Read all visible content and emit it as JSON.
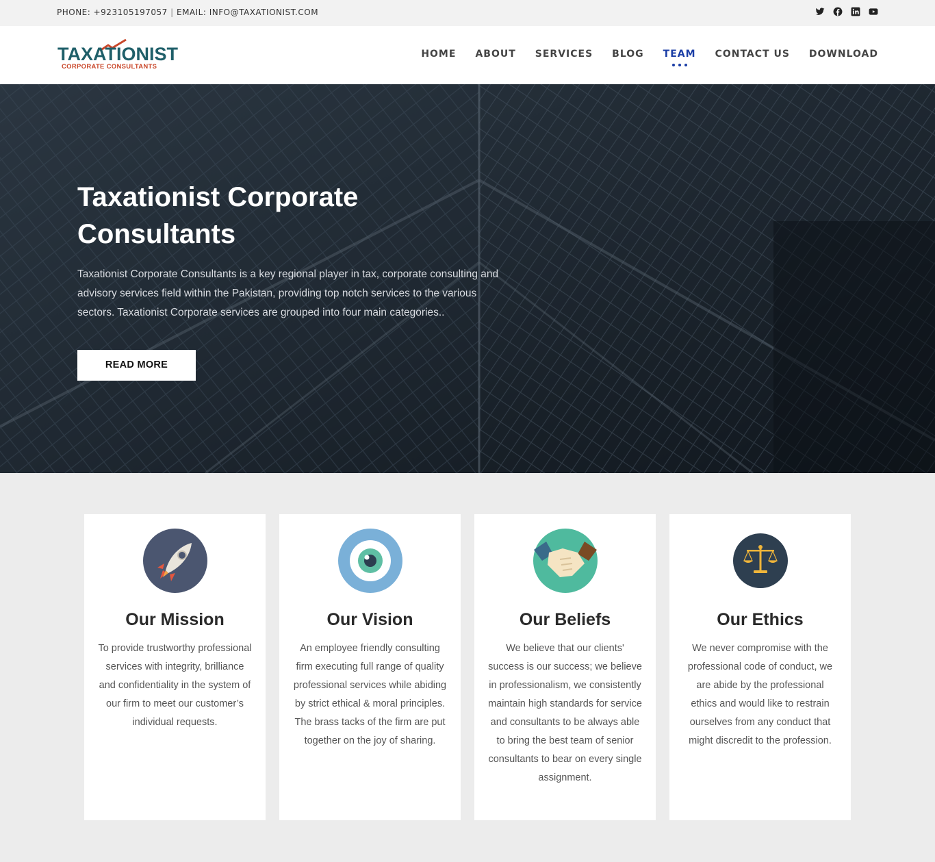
{
  "topbar": {
    "contact_text": "PHONE: +923105197057",
    "separator": "|",
    "email_text": "EMAIL: INFO@TAXATIONIST.COM",
    "social_icons": [
      "twitter-icon",
      "facebook-icon",
      "linkedin-icon",
      "youtube-icon"
    ]
  },
  "logo": {
    "main": "TAXATIONIST",
    "sub": "CORPORATE CONSULTANTS"
  },
  "nav": {
    "items": [
      {
        "label": "HOME"
      },
      {
        "label": "ABOUT"
      },
      {
        "label": "SERVICES"
      },
      {
        "label": "BLOG"
      },
      {
        "label": "TEAM"
      },
      {
        "label": "CONTACT US"
      },
      {
        "label": "DOWNLOAD"
      }
    ],
    "active": "TEAM",
    "active_color": "#1b3ea6"
  },
  "hero": {
    "title": "Taxationist Corporate Consultants",
    "description": "Taxationist Corporate Consultants is a key regional player in tax, corporate consulting and advisory services field within the Pakistan, providing top notch services to the various sectors. Taxationist Corporate services are grouped into four main categories..",
    "button_label": "READ MORE"
  },
  "cards": [
    {
      "icon": "rocket-icon",
      "title": "Our Mission",
      "text": "To provide trustworthy professional services with integrity, brilliance and confidentiality in the system of our firm to meet our customer’s individual requests."
    },
    {
      "icon": "eye-icon",
      "title": "Our Vision",
      "text": "An employee friendly consulting firm executing full range of quality professional services while abiding by strict ethical & moral principles. The brass tacks of the firm are put together on the joy of sharing."
    },
    {
      "icon": "handshake-icon",
      "title": "Our Beliefs",
      "text": "We believe that our clients' success is our success; we believe in professionalism, we consistently maintain high standards for service and consultants to be always able to bring the best team of senior consultants to bear on every single assignment."
    },
    {
      "icon": "scales-icon",
      "title": "Our Ethics",
      "text": "We never compromise with the professional code of conduct, we are abide by the professional ethics and would like to restrain ourselves from any conduct that might discredit to the profession."
    }
  ],
  "colors": {
    "brand_teal": "#1f5f69",
    "brand_orange": "#c9472a",
    "page_bg": "#ececec"
  }
}
